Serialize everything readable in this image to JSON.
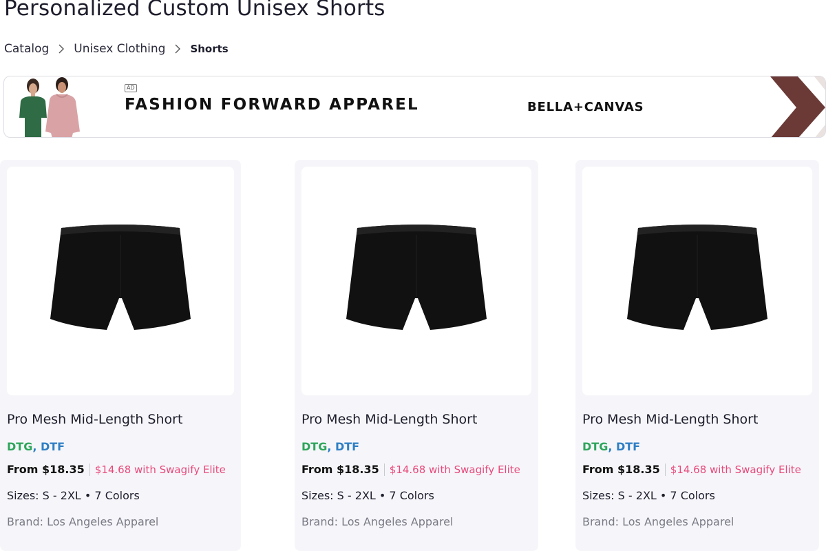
{
  "page": {
    "title": "Personalized Custom Unisex Shorts"
  },
  "breadcrumb": {
    "items": [
      "Catalog",
      "Unisex Clothing"
    ],
    "current": "Shorts"
  },
  "ad": {
    "badge": "AD",
    "headline": "FASHION FORWARD APPAREL",
    "brand": "BELLA+CANVAS",
    "accent_color": "#6b3a36"
  },
  "products": [
    {
      "title": "Pro Mesh Mid-Length Short",
      "method_1": "DTG",
      "separator": ",",
      "method_2": "DTF",
      "price_from": "From $18.35",
      "price_elite": "$14.68 with Swagify Elite",
      "sizes": "Sizes: S - 2XL • 7 Colors",
      "brand": "Brand: Los Angeles Apparel"
    },
    {
      "title": "Pro Mesh Mid-Length Short",
      "method_1": "DTG",
      "separator": ",",
      "method_2": "DTF",
      "price_from": "From $18.35",
      "price_elite": "$14.68 with Swagify Elite",
      "sizes": "Sizes: S - 2XL • 7 Colors",
      "brand": "Brand: Los Angeles Apparel"
    },
    {
      "title": "Pro Mesh Mid-Length Short",
      "method_1": "DTG",
      "separator": ",",
      "method_2": "DTF",
      "price_from": "From $18.35",
      "price_elite": "$14.68 with Swagify Elite",
      "sizes": "Sizes: S - 2XL • 7 Colors",
      "brand": "Brand: Los Angeles Apparel"
    }
  ],
  "colors": {
    "dtg": "#2ea55b",
    "dtf": "#2e7fc4",
    "elite_price": "#e8497a",
    "card_bg": "#f6f6fa"
  },
  "icons": {
    "breadcrumb_separator": "chevron-right-icon",
    "product_image": "black-shorts-image"
  }
}
